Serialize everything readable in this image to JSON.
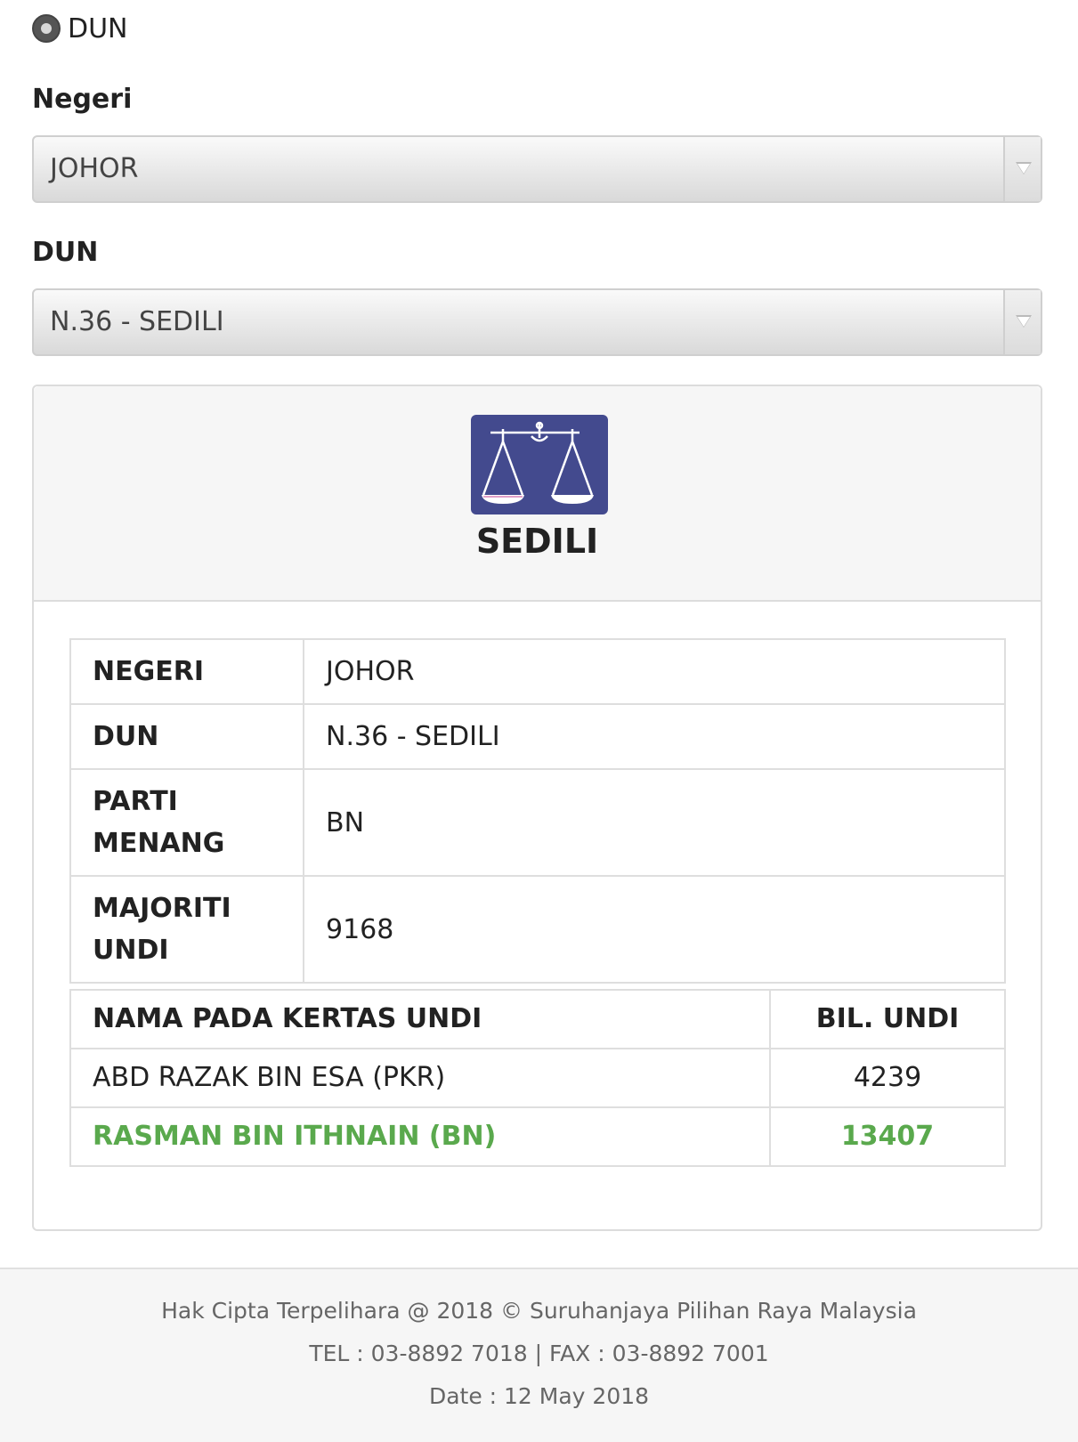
{
  "radio": {
    "label": "DUN"
  },
  "negeri": {
    "label": "Negeri",
    "value": "JOHOR"
  },
  "dun": {
    "label": "DUN",
    "value": "N.36 - SEDILI"
  },
  "panel": {
    "title": "SEDILI",
    "logo_icon": "scales-of-justice-icon",
    "logo_color": "#434a8e",
    "info": [
      {
        "key": "NEGERI",
        "value": "JOHOR"
      },
      {
        "key": "DUN",
        "value": "N.36 - SEDILI"
      },
      {
        "key": "PARTI MENANG",
        "value": "BN"
      },
      {
        "key": "MAJORITI UNDI",
        "value": "9168"
      }
    ],
    "candidates": {
      "header_name": "NAMA PADA KERTAS UNDI",
      "header_votes": "BIL. UNDI",
      "rows": [
        {
          "name": "ABD RAZAK BIN ESA (PKR)",
          "votes": "4239",
          "winner": false
        },
        {
          "name": "RASMAN BIN ITHNAIN (BN)",
          "votes": "13407",
          "winner": true
        }
      ],
      "winner_color": "#5aa94d"
    }
  },
  "footer": {
    "copyright": "Hak Cipta Terpelihara @ 2018 © Suruhanjaya Pilihan Raya Malaysia",
    "contact": "TEL : 03-8892 7018 | FAX : 03-8892 7001",
    "date": "Date : 12 May 2018"
  }
}
